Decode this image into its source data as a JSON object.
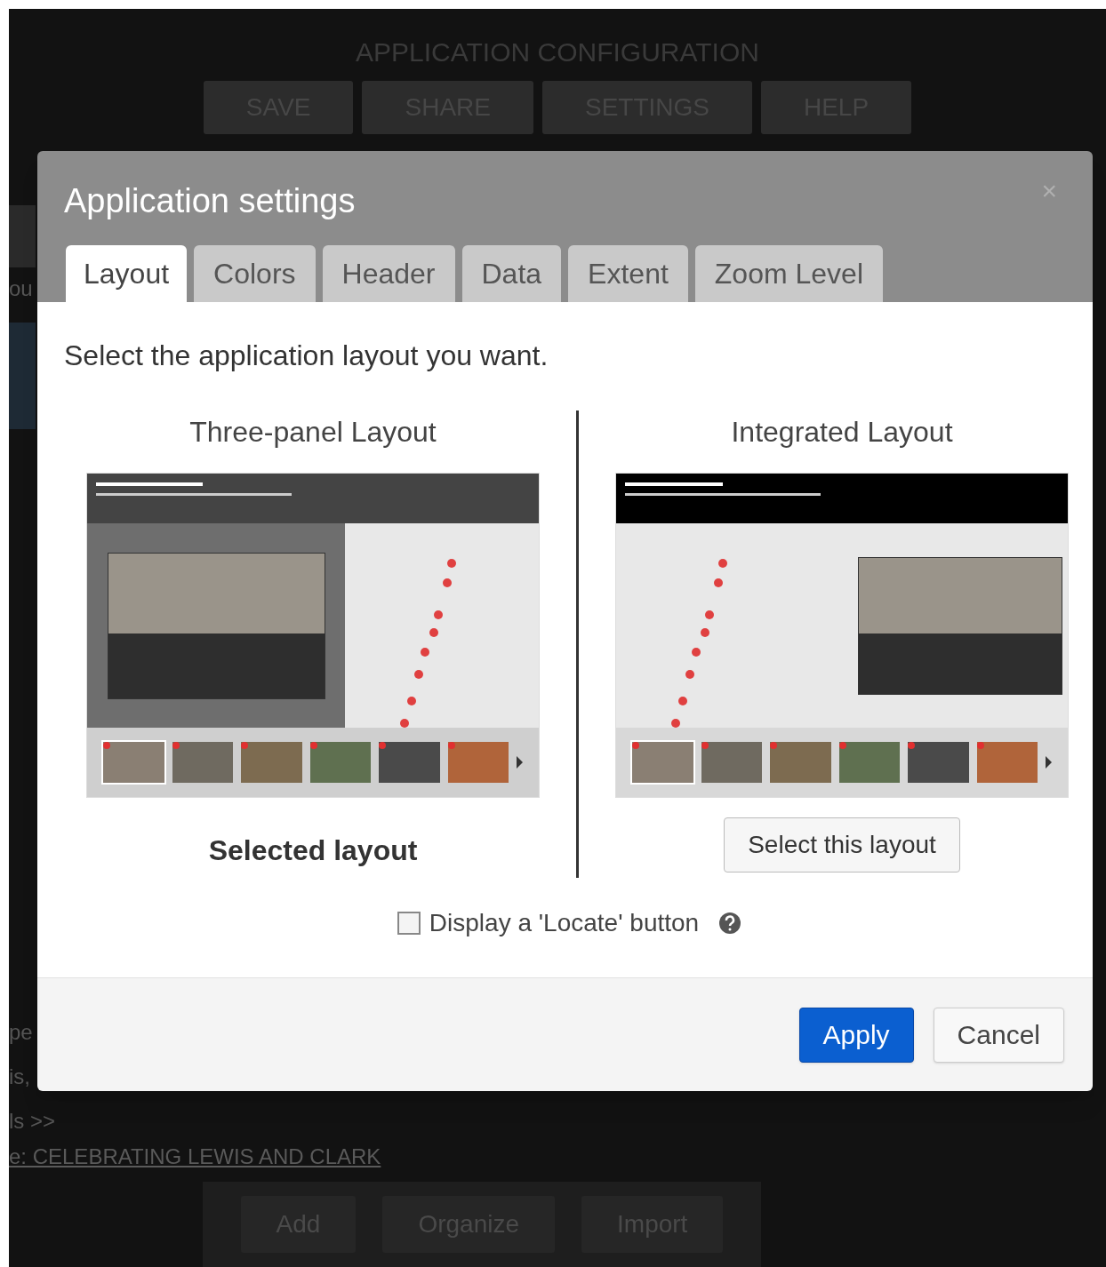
{
  "background": {
    "title": "APPLICATION CONFIGURATION",
    "toolbar": [
      "SAVE",
      "SHARE",
      "SETTINGS",
      "HELP"
    ],
    "side_fragments": [
      "ou",
      "pe",
      "is,",
      "ls >>"
    ],
    "link": "e: CELEBRATING LEWIS AND CLARK",
    "bottom_buttons": [
      "Add",
      "Organize",
      "Import"
    ]
  },
  "dialog": {
    "title": "Application settings",
    "close": "×",
    "tabs": [
      {
        "label": "Layout",
        "selected": true
      },
      {
        "label": "Colors",
        "selected": false
      },
      {
        "label": "Header",
        "selected": false
      },
      {
        "label": "Data",
        "selected": false
      },
      {
        "label": "Extent",
        "selected": false
      },
      {
        "label": "Zoom Level",
        "selected": false
      }
    ],
    "prompt": "Select the application layout you want.",
    "layouts": [
      {
        "title": "Three-panel Layout",
        "kind": "three-panel",
        "selected": true,
        "action": "Selected layout"
      },
      {
        "title": "Integrated Layout",
        "kind": "integrated",
        "selected": false,
        "action": "Select this layout"
      }
    ],
    "locate": {
      "label": "Display a 'Locate' button",
      "checked": false
    },
    "buttons": [
      {
        "label": "Apply",
        "kind": "primary"
      },
      {
        "label": "Cancel",
        "kind": "secondary"
      }
    ]
  }
}
